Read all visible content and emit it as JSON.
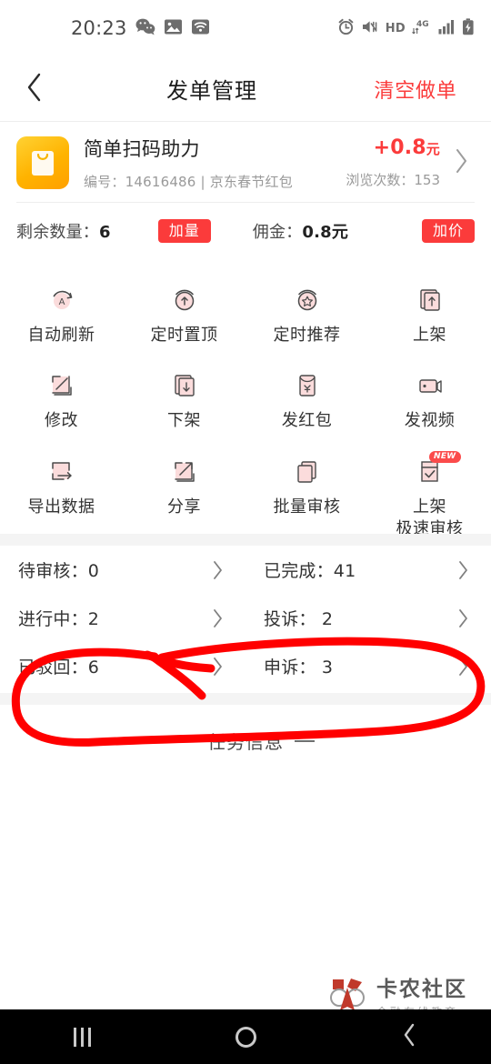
{
  "statusbar": {
    "time": "20:23",
    "left_icons": [
      "wechat-icon",
      "gallery-icon",
      "wifi-icon"
    ],
    "hd_label": "HD",
    "network_label": "4G",
    "right_icons": [
      "alarm-icon",
      "mute-vibrate-icon",
      "hd-icon",
      "network-4g-icon",
      "signal-icon",
      "battery-charging-icon"
    ]
  },
  "header": {
    "back_icon": "chevron-left-icon",
    "title": "发单管理",
    "action_label": "清空做单",
    "action_color": "#fb3b3b"
  },
  "card": {
    "thumb_icon": "shopping-bag-icon",
    "title": "简单扫码助力",
    "subtitle": "编号：14616486 | 京东春节红包",
    "price": "+0.8",
    "price_unit": "元",
    "views": "浏览次数：153",
    "chevron_icon": "chevron-right-icon",
    "remaining_label": "剩余数量：",
    "remaining_value": "6",
    "add_quantity_label": "加量",
    "commission_label": "佣金：",
    "commission_value": "0.8元",
    "add_price_label": "加价",
    "button_color": "#fb3b3b"
  },
  "actions": [
    {
      "label": "自动刷新",
      "icon": "auto-refresh-icon"
    },
    {
      "label": "定时置顶",
      "icon": "timed-pin-top-icon"
    },
    {
      "label": "定时推荐",
      "icon": "timed-recommend-icon"
    },
    {
      "label": "上架",
      "icon": "publish-up-icon"
    },
    {
      "label": "修改",
      "icon": "edit-pencil-icon"
    },
    {
      "label": "下架",
      "icon": "unpublish-down-icon"
    },
    {
      "label": "发红包",
      "icon": "red-envelope-icon"
    },
    {
      "label": "发视频",
      "icon": "video-camera-icon"
    },
    {
      "label": "导出数据",
      "icon": "export-data-icon"
    },
    {
      "label": "分享",
      "icon": "share-arrow-icon"
    },
    {
      "label": "批量审核",
      "icon": "batch-review-icon"
    },
    {
      "label": "上架\n极速审核",
      "label_line1": "上架",
      "label_line2": "极速审核",
      "icon": "fast-review-checkbox-icon",
      "badge": "NEW"
    }
  ],
  "status_list": [
    {
      "left_label": "待审核：0",
      "right_label": "已完成：41"
    },
    {
      "left_label": "进行中：2",
      "right_label": "投诉：  2"
    },
    {
      "left_label": "已驳回：6",
      "right_label": "申诉：  3"
    }
  ],
  "section": {
    "title": "任务信息"
  },
  "annotation": {
    "color": "#ff0000",
    "shape": "hand-drawn-circle-with-cross"
  },
  "watermark": {
    "main": "卡农社区",
    "sub": "金融在线教育"
  },
  "navbar": {
    "recents_icon": "recents-icon",
    "home_icon": "home-icon",
    "back_icon": "nav-back-icon"
  }
}
